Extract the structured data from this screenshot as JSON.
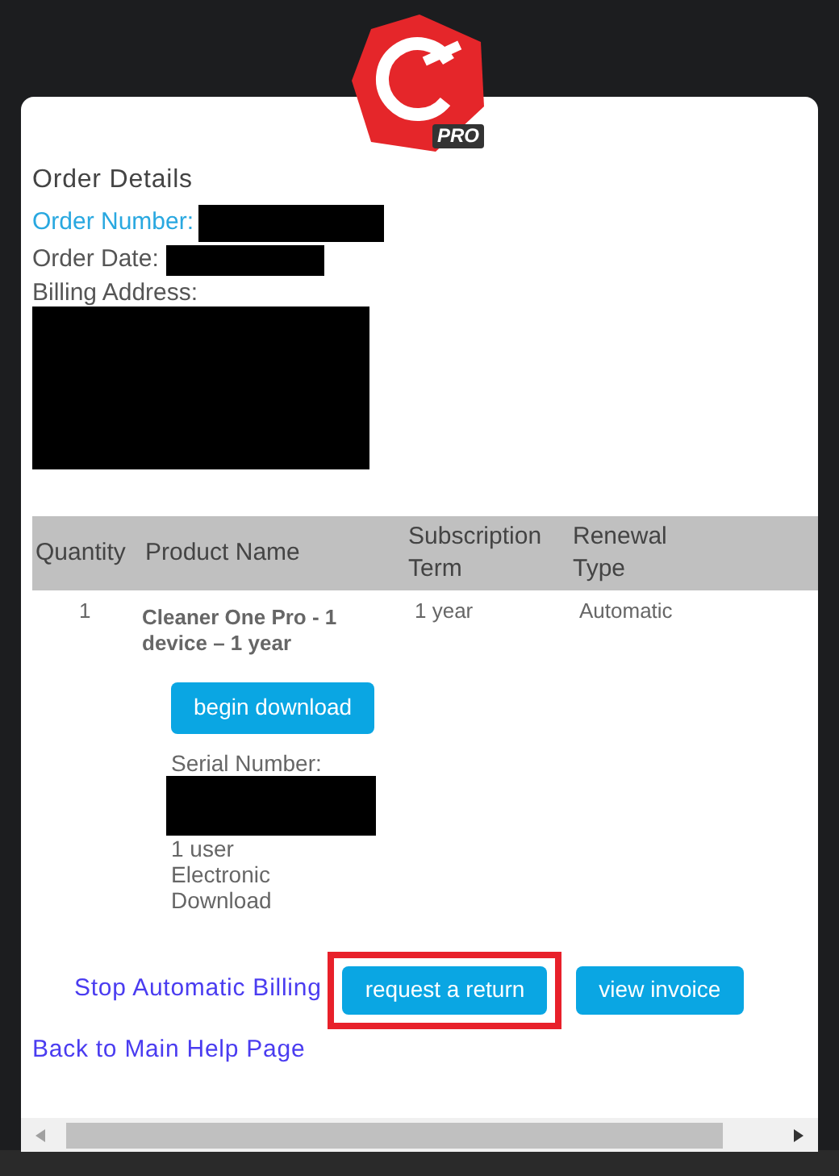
{
  "logo": {
    "badge": "PRO"
  },
  "order": {
    "title": "Order Details",
    "number_label": "Order Number:",
    "date_label": "Order Date:",
    "address_label": "Billing Address:"
  },
  "table": {
    "columns": [
      "Quantity",
      "Product Name",
      "Subscription Term",
      "Renewal Type"
    ],
    "rows": [
      {
        "quantity": "1",
        "product": "Cleaner One Pro - 1 device – 1 year",
        "term": "1 year",
        "renewal": "Automatic",
        "download_button": "begin download",
        "serial_label": "Serial Number:",
        "details": [
          "1 user",
          "Electronic Download"
        ]
      }
    ]
  },
  "actions": {
    "stop_link": "Stop Automatic Billing",
    "buttons": [
      {
        "label": "request a return",
        "highlighted": true
      },
      {
        "label": "view invoice",
        "highlighted": false
      }
    ],
    "back_link": "Back to Main Help Page"
  }
}
